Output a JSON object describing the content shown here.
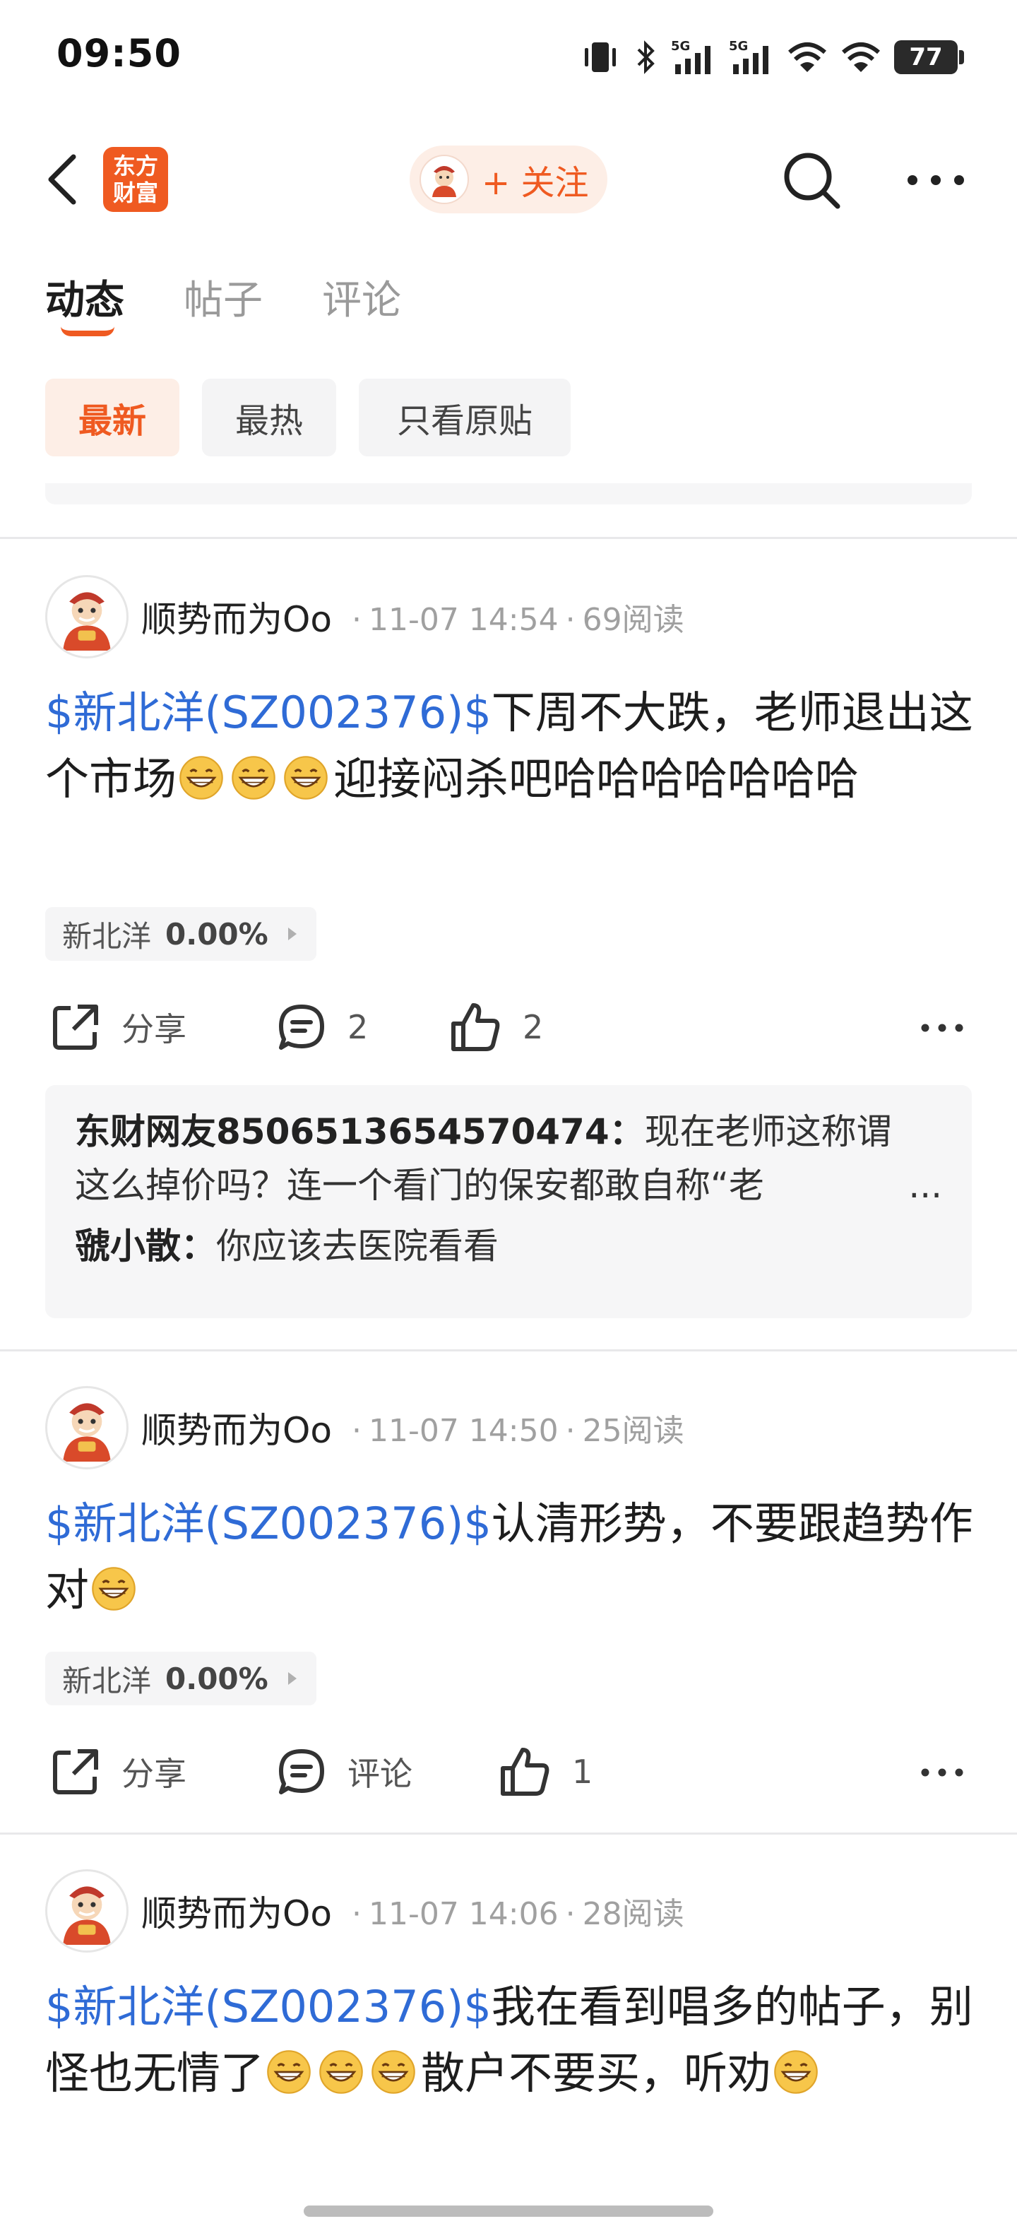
{
  "status_bar": {
    "time": "09:50",
    "battery": "77"
  },
  "nav": {
    "logo_text_line1": "东方",
    "logo_text_line2": "财富",
    "follow_label": "+ 关注"
  },
  "tabs": [
    {
      "label": "动态",
      "active": true
    },
    {
      "label": "帖子",
      "active": false
    },
    {
      "label": "评论",
      "active": false
    }
  ],
  "filters": [
    {
      "label": "最新",
      "active": true
    },
    {
      "label": "最热",
      "active": false
    },
    {
      "label": "只看原贴",
      "active": false
    }
  ],
  "colors": {
    "accent": "#ef5a21",
    "link": "#2f6bd6",
    "chip_active_bg": "#fdeee6"
  },
  "posts": [
    {
      "author": "顺势而为Oo",
      "date": "11-07 14:54",
      "reads": "69阅读",
      "stock_link": "$新北洋(SZ002376)$",
      "text_1": "下周不大跌，老师退出这个市场",
      "text_2": "迎接闷杀吧哈哈哈哈哈哈哈",
      "tag_name": "新北洋",
      "tag_pct": "0.00%",
      "share_label": "分享",
      "comment_count": "2",
      "like_count": "2",
      "comments": [
        {
          "name": "东财网友8506513654570474：",
          "text": "现在老师这称谓这么掉价吗？连一个看门的保安都敢自称“老",
          "ellipsis": "..."
        },
        {
          "name": "虢小散：",
          "text": "你应该去医院看看"
        }
      ]
    },
    {
      "author": "顺势而为Oo",
      "date": "11-07 14:50",
      "reads": "25阅读",
      "stock_link": "$新北洋(SZ002376)$",
      "text_1": "认清形势，不要跟趋势作对",
      "tag_name": "新北洋",
      "tag_pct": "0.00%",
      "share_label": "分享",
      "comment_label": "评论",
      "like_count": "1"
    },
    {
      "author": "顺势而为Oo",
      "date": "11-07 14:06",
      "reads": "28阅读",
      "stock_link": "$新北洋(SZ002376)$",
      "text_1": "我在看到唱多的帖子，别怪也无情了",
      "text_2": "散户不要买，听劝"
    }
  ]
}
